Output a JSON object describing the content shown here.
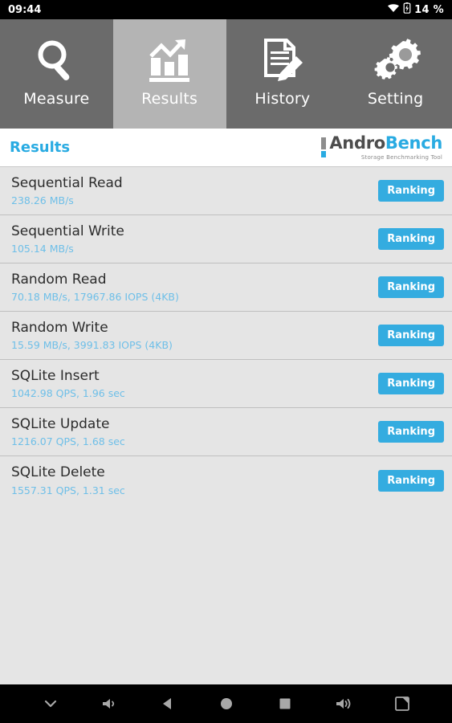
{
  "statusbar": {
    "time": "09:44",
    "battery_pct": "14 %",
    "icons": [
      "wifi-icon",
      "battery-charging-icon"
    ]
  },
  "tabs": [
    {
      "label": "Measure",
      "icon": "magnifier-icon",
      "selected": false
    },
    {
      "label": "Results",
      "icon": "bar-chart-arrow-icon",
      "selected": true
    },
    {
      "label": "History",
      "icon": "document-pencil-icon",
      "selected": false
    },
    {
      "label": "Setting",
      "icon": "gears-icon",
      "selected": false
    }
  ],
  "header": {
    "title": "Results",
    "logo": {
      "name_part1": "Andro",
      "name_part2": "Bench",
      "tagline": "Storage Benchmarking Tool"
    }
  },
  "results": {
    "button_label": "Ranking",
    "rows": [
      {
        "title": "Sequential Read",
        "value": "238.26 MB/s"
      },
      {
        "title": "Sequential Write",
        "value": "105.14 MB/s"
      },
      {
        "title": "Random Read",
        "value": "70.18 MB/s, 17967.86 IOPS (4KB)"
      },
      {
        "title": "Random Write",
        "value": "15.59 MB/s, 3991.83 IOPS (4KB)"
      },
      {
        "title": "SQLite Insert",
        "value": "1042.98 QPS, 1.96 sec"
      },
      {
        "title": "SQLite Update",
        "value": "1216.07 QPS, 1.68 sec"
      },
      {
        "title": "SQLite Delete",
        "value": "1557.31 QPS, 1.31 sec"
      }
    ]
  },
  "navbar": {
    "buttons": [
      {
        "icon": "chevron-down-icon"
      },
      {
        "icon": "volume-down-icon"
      },
      {
        "icon": "back-icon"
      },
      {
        "icon": "home-icon"
      },
      {
        "icon": "recents-icon"
      },
      {
        "icon": "volume-up-icon"
      },
      {
        "icon": "fullscreen-icon"
      }
    ]
  },
  "colors": {
    "accent_blue": "#29abe2",
    "button_blue": "#34ace0",
    "subtitle_blue": "#6ebfe8",
    "tab_unselected": "#6b6b6b",
    "tab_selected": "#b4b4b4",
    "list_bg": "#e5e5e5"
  }
}
